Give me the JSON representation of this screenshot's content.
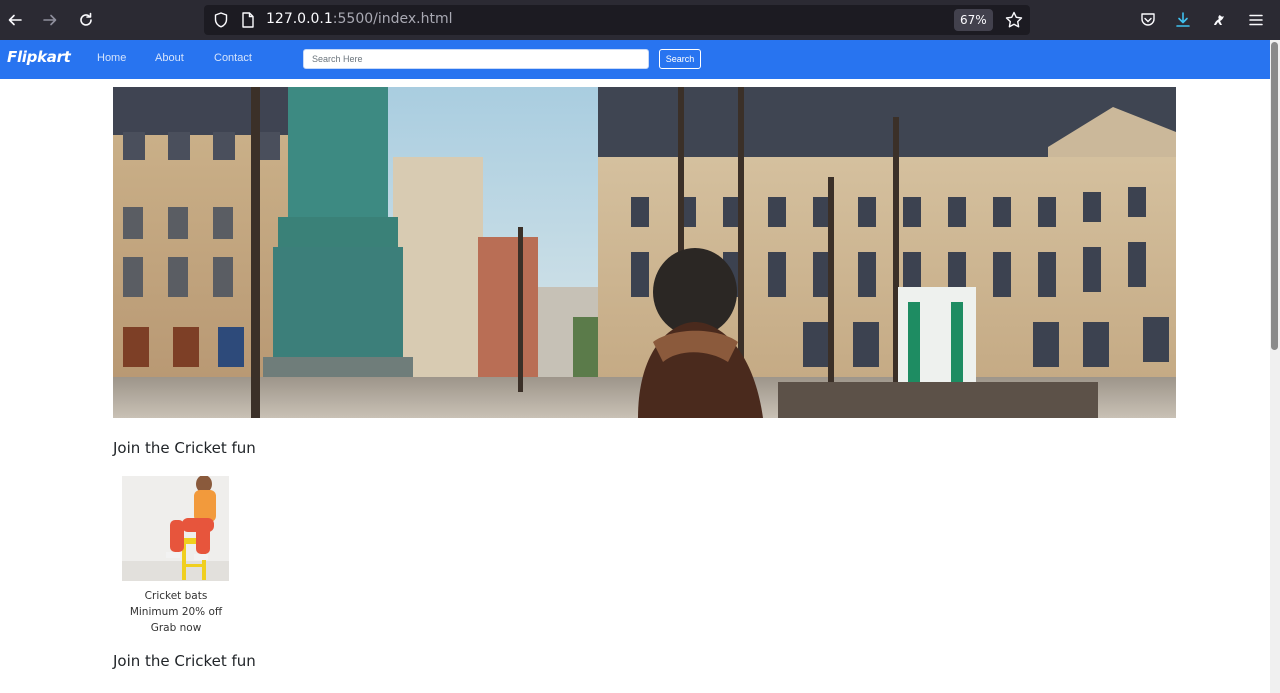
{
  "browser": {
    "url_host": "127.0.0.1",
    "url_rest": ":5500/index.html",
    "zoom": "67%"
  },
  "navbar": {
    "brand": "Flipkart",
    "links": [
      "Home",
      "About",
      "Contact"
    ],
    "search_placeholder": "Search Here",
    "search_button": "Search"
  },
  "sections": [
    {
      "title": "Join the Cricket fun",
      "card": {
        "line1": "Cricket bats",
        "line2": "Minimum 20% off",
        "line3": "Grab now"
      }
    },
    {
      "title": "Join the Cricket fun"
    }
  ],
  "colors": {
    "navbar": "#2874f0",
    "chrome": "#2b2a33"
  }
}
